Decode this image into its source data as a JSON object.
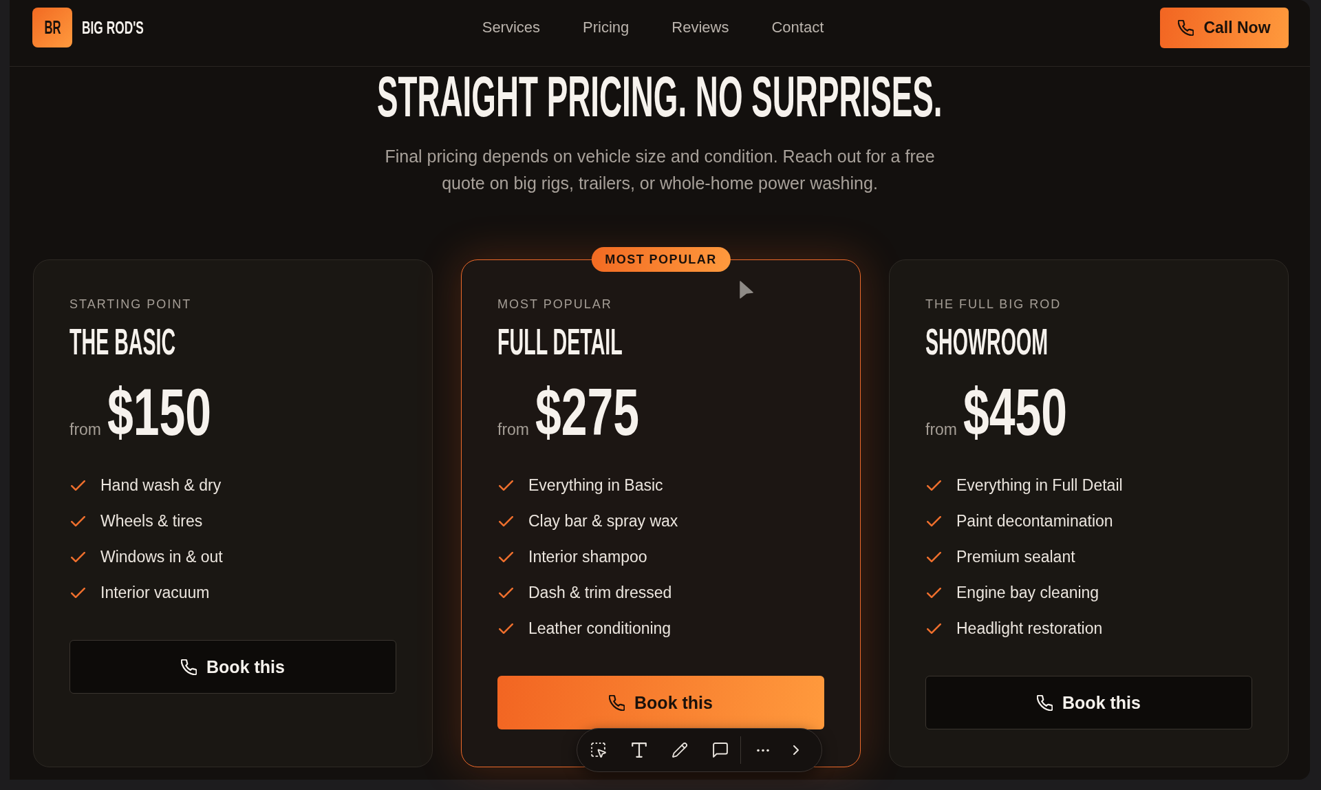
{
  "header": {
    "logo": {
      "initials": "BR",
      "name": "BIG ROD'S"
    },
    "nav": [
      {
        "label": "Services"
      },
      {
        "label": "Pricing"
      },
      {
        "label": "Reviews"
      },
      {
        "label": "Contact"
      }
    ],
    "call_button": {
      "label": "Call Now"
    }
  },
  "hero": {
    "title": "STRAIGHT PRICING. NO SURPRISES.",
    "subtitle": "Final pricing depends on vehicle size and condition. Reach out for a free quote on big rigs, trailers, or whole-home power washing."
  },
  "plans": [
    {
      "eyebrow": "STARTING POINT",
      "name": "THE BASIC",
      "price_prefix": "from",
      "price": "$150",
      "featured": false,
      "features": [
        "Hand wash & dry",
        "Wheels & tires",
        "Windows in & out",
        "Interior vacuum"
      ],
      "button": "Book this"
    },
    {
      "badge": "MOST POPULAR",
      "eyebrow": "MOST POPULAR",
      "name": "FULL DETAIL",
      "price_prefix": "from",
      "price": "$275",
      "featured": true,
      "features": [
        "Everything in Basic",
        "Clay bar & spray wax",
        "Interior shampoo",
        "Dash & trim dressed",
        "Leather conditioning"
      ],
      "button": "Book this"
    },
    {
      "eyebrow": "THE FULL BIG ROD",
      "name": "SHOWROOM",
      "price_prefix": "from",
      "price": "$450",
      "featured": false,
      "features": [
        "Everything in Full Detail",
        "Paint decontamination",
        "Premium sealant",
        "Engine bay cleaning",
        "Headlight restoration"
      ],
      "button": "Book this"
    }
  ]
}
